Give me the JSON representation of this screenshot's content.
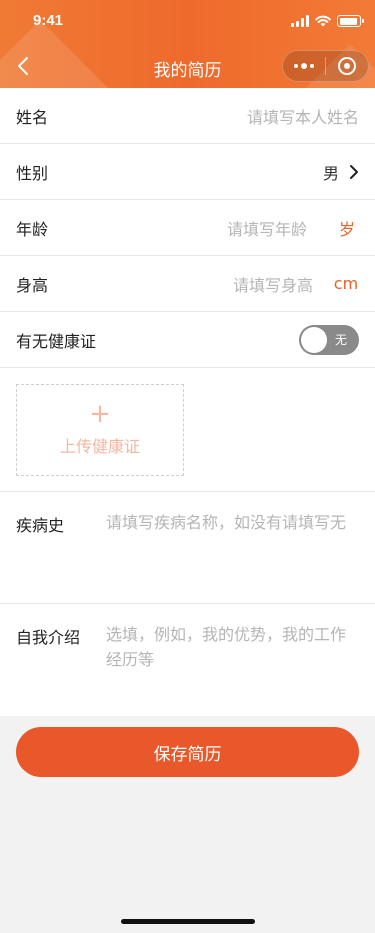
{
  "status_bar": {
    "time": "9:41"
  },
  "nav": {
    "title": "我的简历"
  },
  "form": {
    "name": {
      "label": "姓名",
      "placeholder": "请填写本人姓名"
    },
    "gender": {
      "label": "性别",
      "value": "男"
    },
    "age": {
      "label": "年龄",
      "placeholder": "请填写年龄",
      "unit": "岁"
    },
    "height": {
      "label": "身高",
      "placeholder": "请填写身高",
      "unit": "cm"
    },
    "health_cert": {
      "label": "有无健康证",
      "toggle_label": "无",
      "enabled": false
    },
    "upload": {
      "plus": "+",
      "label": "上传健康证"
    },
    "disease": {
      "label": "疾病史",
      "placeholder": "请填写疾病名称，如没有请填写无"
    },
    "intro": {
      "label": "自我介绍",
      "placeholder": "选填，例如，我的优势，我的工作经历等"
    }
  },
  "actions": {
    "save_label": "保存简历"
  },
  "colors": {
    "accent": "#e9582a",
    "header": "#f07a35"
  }
}
